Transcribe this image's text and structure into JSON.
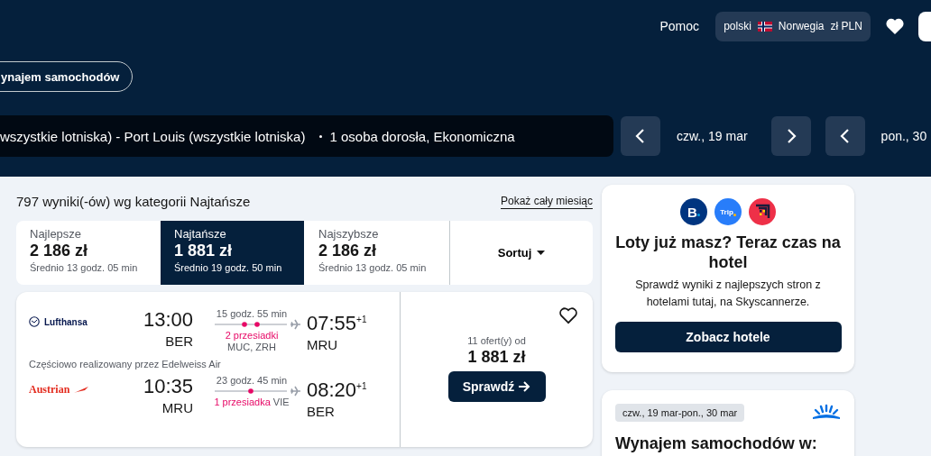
{
  "header": {
    "help": "Pomoc",
    "locale": {
      "language": "polski",
      "country": "Norwegia",
      "currency": "zł PLN"
    },
    "chip": "ynajem samochodów",
    "search": {
      "route": "wszystkie lotniska) - Port Louis (wszystkie lotniska)",
      "passengers": "1 osoba dorosła, Ekonomiczna"
    },
    "dates": [
      {
        "label": "czw., 19 mar"
      },
      {
        "label": "pon., 30"
      }
    ]
  },
  "results": {
    "summary": "797 wyniki(-ów) wg kategorii Najtańsze",
    "month_link": "Pokaż cały miesiąc",
    "tabs": [
      {
        "label": "Najlepsze",
        "price": "2 186 zł",
        "avg": "Średnio 13 godz. 05 min",
        "selected": false
      },
      {
        "label": "Najtańsze",
        "price": "1 881 zł",
        "avg": "Średnio 19 godz. 50 min",
        "selected": true
      },
      {
        "label": "Najszybsze",
        "price": "2 186 zł",
        "avg": "Średnio 13 godz. 05 min",
        "selected": false
      }
    ],
    "sort": "Sortuj",
    "card": {
      "legs": [
        {
          "airline": "Lufthansa",
          "kind": "lufthansa",
          "dep_time": "13:00",
          "dep_airport": "BER",
          "duration": "15 godz. 55 min",
          "stops_label": "2 przesiadki",
          "stops": [
            "MUC,",
            "ZRH"
          ],
          "stops_inline": false,
          "arr_time": "07:55",
          "day_offset": "+1",
          "arr_airport": "MRU",
          "note": "Częściowo realizowany przez Edelweiss Air"
        },
        {
          "airline": "Austrian",
          "kind": "austrian",
          "dep_time": "10:35",
          "dep_airport": "MRU",
          "duration": "23 godz. 45 min",
          "stops_label": "1 przesiadka",
          "stops": [
            "VIE"
          ],
          "stops_inline": true,
          "arr_time": "08:20",
          "day_offset": "+1",
          "arr_airport": "BER"
        }
      ],
      "offers": "11 ofert(y) od",
      "price": "1 881 zł",
      "button": "Sprawdź"
    }
  },
  "hotel_card": {
    "partners": [
      {
        "kind": "booking",
        "text": "B"
      },
      {
        "kind": "trip",
        "text": "Trip"
      },
      {
        "kind": "agoda"
      }
    ],
    "title": "Loty już masz? Teraz czas na hotel",
    "text": "Sprawdź wyniki z najlepszych stron z hotelami tutaj, na Skyscannerze.",
    "button": "Zobacz hotele"
  },
  "car_card": {
    "dates": "czw., 19 mar-pon., 30 mar",
    "title": "Wynajem samochodów w:"
  }
}
